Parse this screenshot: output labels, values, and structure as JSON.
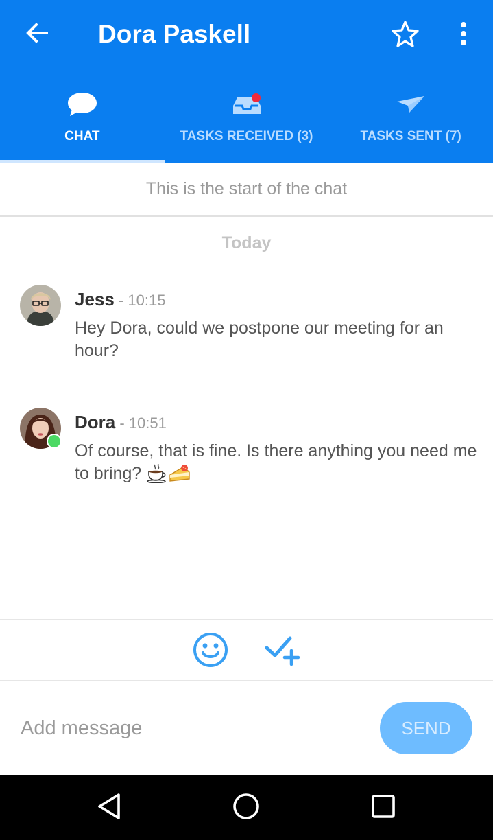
{
  "header": {
    "title": "Dora Paskell",
    "back_icon": "arrow-left-icon",
    "favorite_icon": "star-outline-icon",
    "more_icon": "more-vertical-icon"
  },
  "tabs": [
    {
      "label": "CHAT",
      "icon": "chat-bubble-icon",
      "active": true
    },
    {
      "label": "TASKS RECEIVED (3)",
      "icon": "inbox-tray-icon",
      "active": false,
      "has_notification": true
    },
    {
      "label": "TASKS SENT (7)",
      "icon": "paper-plane-icon",
      "active": false
    }
  ],
  "chat": {
    "start_notice": "This is the start of the chat",
    "date_divider": "Today",
    "messages": [
      {
        "author": "Jess",
        "separator": " - ",
        "time": "10:15",
        "text": "Hey Dora, could we postpone our meeting for an hour?",
        "avatar": "avatar-jess",
        "online": false
      },
      {
        "author": "Dora",
        "separator": " - ",
        "time": "10:51",
        "text": "Of course, that is fine. Is there anything you need me to bring?",
        "emojis": [
          "coffee-emoji",
          "cake-emoji"
        ],
        "avatar": "avatar-dora",
        "online": true
      }
    ]
  },
  "composer": {
    "emoji_icon": "smiley-icon",
    "add_task_icon": "check-plus-icon",
    "placeholder": "Add message",
    "value": "",
    "send_label": "SEND"
  },
  "system_nav": {
    "back_icon": "nav-back-triangle-icon",
    "home_icon": "nav-home-circle-icon",
    "recents_icon": "nav-recents-square-icon"
  },
  "colors": {
    "primary": "#0a7ef0",
    "tab_inactive_text": "#b9dcff",
    "notification_dot": "#f2293a",
    "online_dot": "#4cd964",
    "send_button": "#6ebcff",
    "accent_icon": "#3aa0f3"
  }
}
